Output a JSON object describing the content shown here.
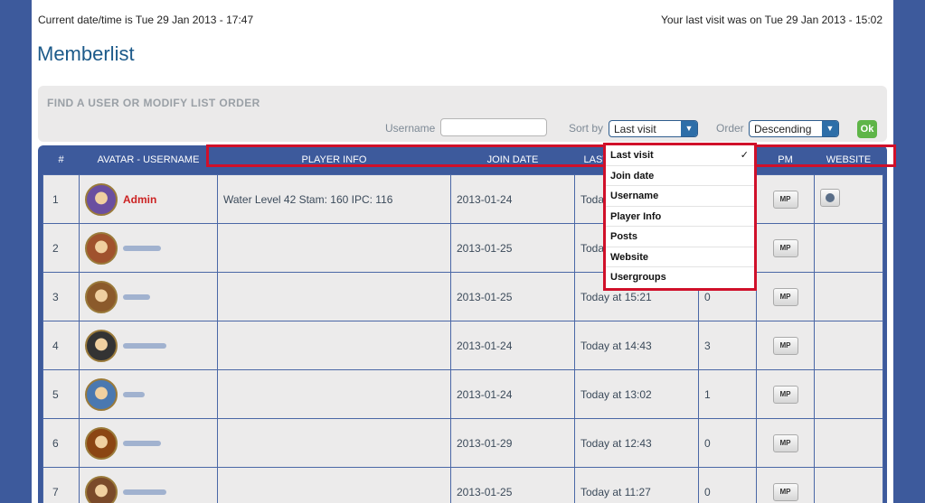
{
  "header": {
    "current_datetime": "Current date/time is Tue 29 Jan 2013 - 17:47",
    "last_visit": "Your last visit was on Tue 29 Jan 2013 - 15:02"
  },
  "page_title": "Memberlist",
  "finder": {
    "title": "FIND A USER OR MODIFY LIST ORDER",
    "username_label": "Username",
    "username_value": "",
    "sortby_label": "Sort by",
    "sortby_value": "Last visit",
    "order_label": "Order",
    "order_value": "Descending",
    "ok_label": "Ok"
  },
  "sort_options": [
    {
      "label": "Last visit",
      "selected": true
    },
    {
      "label": "Join date"
    },
    {
      "label": "Username"
    },
    {
      "label": "Player Info"
    },
    {
      "label": "Posts"
    },
    {
      "label": "Website"
    },
    {
      "label": "Usergroups"
    }
  ],
  "check_mark": "✓",
  "table": {
    "headers": [
      "#",
      "AVATAR - USERNAME",
      "PLAYER INFO",
      "JOIN DATE",
      "LAST",
      "",
      "PM",
      "WEBSITE"
    ],
    "pm_label": "MP",
    "rows": [
      {
        "num": "1",
        "username": "Admin",
        "player_info": "Water Level 42 Stam: 160 IPC: 116",
        "join": "2013-01-24",
        "last": "Toda",
        "posts": "",
        "website": true
      },
      {
        "num": "2",
        "username": "",
        "player_info": "",
        "join": "2013-01-25",
        "last": "Toda",
        "posts": ""
      },
      {
        "num": "3",
        "username": "",
        "player_info": "",
        "join": "2013-01-25",
        "last": "Today at 15:21",
        "posts": "0"
      },
      {
        "num": "4",
        "username": "",
        "player_info": "",
        "join": "2013-01-24",
        "last": "Today at 14:43",
        "posts": "3"
      },
      {
        "num": "5",
        "username": "",
        "player_info": "",
        "join": "2013-01-24",
        "last": "Today at 13:02",
        "posts": "1"
      },
      {
        "num": "6",
        "username": "",
        "player_info": "",
        "join": "2013-01-29",
        "last": "Today at 12:43",
        "posts": "0"
      },
      {
        "num": "7",
        "username": "",
        "player_info": "",
        "join": "2013-01-25",
        "last": "Today at 11:27",
        "posts": "0"
      }
    ]
  },
  "colors": {
    "page_bg": "#3d5a9c",
    "title": "#1c5a8a",
    "admin": "#cc2222",
    "highlight": "#d0102a",
    "ok": "#5fb548"
  }
}
